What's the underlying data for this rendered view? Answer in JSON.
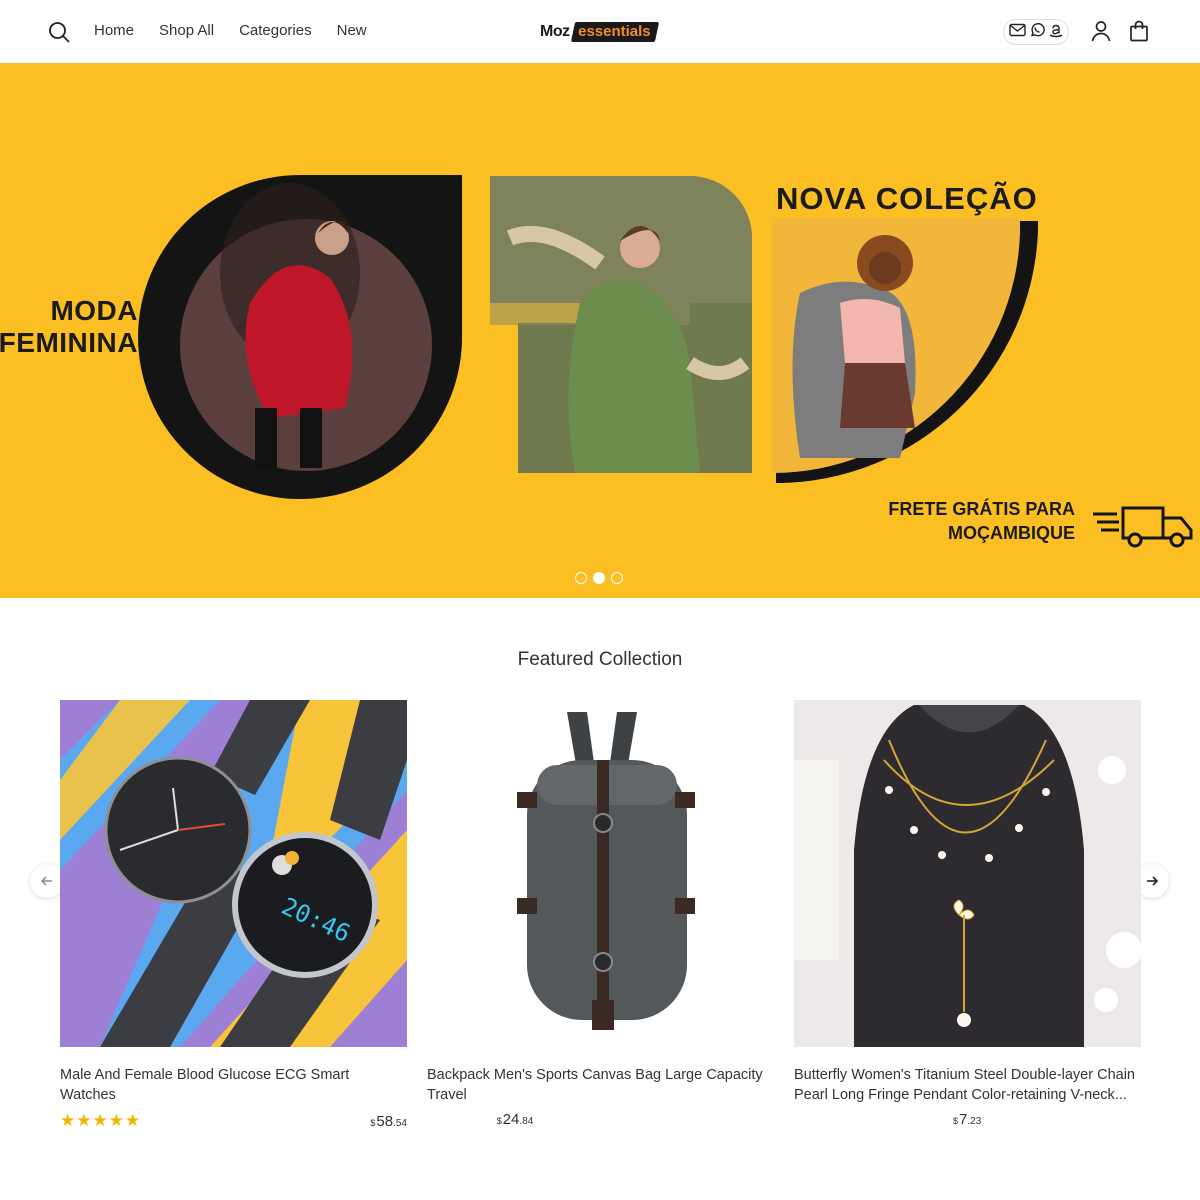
{
  "header": {
    "nav": [
      "Home",
      "Shop All",
      "Categories",
      "New"
    ],
    "logo": {
      "part1": "Moz",
      "part2": "essentials"
    },
    "icons": [
      "search-icon",
      "mail-icon",
      "whatsapp-icon",
      "amazon-icon",
      "account-icon",
      "bag-icon"
    ]
  },
  "hero": {
    "left_line1": "MODA",
    "left_line2": "FEMININA",
    "right_title": "NOVA COLEÇÃO",
    "ship_line1": "FRETE GRÁTIS PARA",
    "ship_line2": "MOÇAMBIQUE",
    "background": "#FBBF24",
    "slides": 3,
    "active_slide": 2
  },
  "featured": {
    "title": "Featured Collection",
    "products": [
      {
        "title": "Male And Female Blood Glucose ECG Smart Watches",
        "currency": "$",
        "price_main": "58",
        "price_cents": ".54",
        "rating": 5,
        "stars": "★★★★★"
      },
      {
        "title": "Backpack Men's Sports Canvas Bag Large Capacity Travel",
        "currency": "$",
        "price_main": "24",
        "price_cents": ".84"
      },
      {
        "title": "Butterfly Women's Titanium Steel Double-layer Chain Pearl Long Fringe Pendant Color-retaining V-neck...",
        "currency": "$",
        "price_main": "7",
        "price_cents": ".23"
      }
    ]
  },
  "colors": {
    "accent": "#FBBF24",
    "logo_accent": "#F28C28",
    "star": "#F5B400"
  }
}
